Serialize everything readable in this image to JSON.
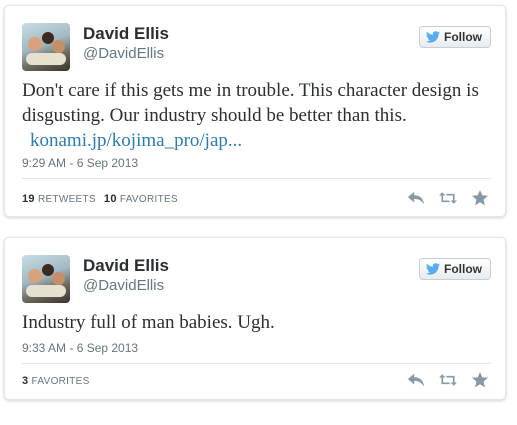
{
  "tweets": [
    {
      "name": "David Ellis",
      "handle": "@DavidEllis",
      "follow_label": "Follow",
      "text": "Don't care if this gets me in trouble. This character design is disgusting. Our industry should be better than this.",
      "link": "konami.jp/kojima_pro/jap...",
      "timestamp": "9:29 AM - 6 Sep 2013",
      "retweets_count": "19",
      "retweets_label": "RETWEETS",
      "favorites_count": "10",
      "favorites_label": "FAVORITES"
    },
    {
      "name": "David Ellis",
      "handle": "@DavidEllis",
      "follow_label": "Follow",
      "text": "Industry full of man babies. Ugh.",
      "timestamp": "9:33 AM - 6 Sep 2013",
      "favorites_count": "3",
      "favorites_label": "FAVORITES"
    }
  ],
  "icons": {
    "follow": "twitter-bird-icon",
    "reply": "reply-icon",
    "retweet": "retweet-icon",
    "favorite": "star-icon"
  },
  "colors": {
    "link": "#2b7bb9",
    "muted": "#66757f",
    "icon": "#8899a6",
    "twitter_blue": "#55acee"
  }
}
